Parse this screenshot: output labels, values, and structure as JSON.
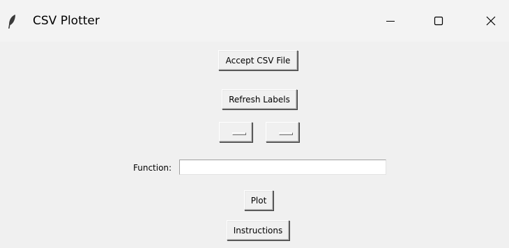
{
  "window": {
    "title": "CSV Plotter",
    "icon": "feather-icon",
    "controls": [
      "minimize-icon",
      "maximize-icon",
      "close-icon"
    ]
  },
  "buttons": {
    "accept_csv": "Accept CSV File",
    "refresh_labels": "Refresh Labels",
    "plot": "Plot",
    "instructions": "Instructions"
  },
  "dropdowns": {
    "first": {
      "value": ""
    },
    "second": {
      "value": ""
    }
  },
  "function_field": {
    "label": "Function:",
    "value": ""
  }
}
